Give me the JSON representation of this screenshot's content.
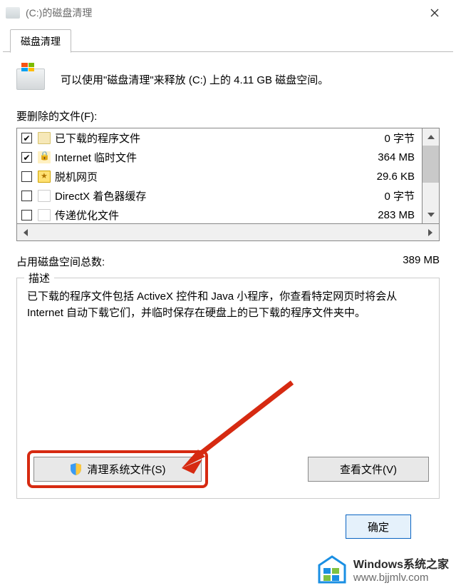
{
  "title": "(C:)的磁盘清理",
  "tab": "磁盘清理",
  "summary": "可以使用\"磁盘清理\"来释放  (C:) 上的 4.11 GB 磁盘空间。",
  "files_label": "要删除的文件(F):",
  "files": [
    {
      "checked": true,
      "icon": "folder",
      "name": "已下载的程序文件",
      "size": "0 字节"
    },
    {
      "checked": true,
      "icon": "lock",
      "name": "Internet 临时文件",
      "size": "364 MB"
    },
    {
      "checked": false,
      "icon": "star",
      "name": "脱机网页",
      "size": "29.6 KB"
    },
    {
      "checked": false,
      "icon": "blank",
      "name": "DirectX 着色器缓存",
      "size": "0 字节"
    },
    {
      "checked": false,
      "icon": "blank",
      "name": "传递优化文件",
      "size": "283 MB"
    }
  ],
  "total_label": "占用磁盘空间总数:",
  "total_value": "389 MB",
  "group_title": "描述",
  "description": "已下载的程序文件包括 ActiveX 控件和 Java 小程序，你查看特定网页时将会从 Internet 自动下载它们，并临时保存在硬盘上的已下载的程序文件夹中。",
  "btn_clean": "清理系统文件(S)",
  "btn_view": "查看文件(V)",
  "btn_ok": "确定",
  "watermark": {
    "line1": "Windows系统之家",
    "line2": "www.bjjmlv.com"
  }
}
